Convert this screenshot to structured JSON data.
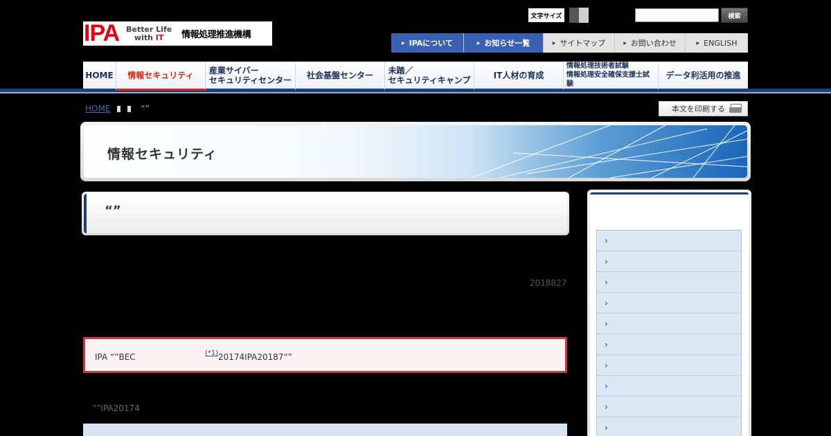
{
  "header": {
    "logo_mark": "IPA",
    "logo_tag_1": "Better Life",
    "logo_tag_2_a": "with ",
    "logo_tag_2_b": "IT",
    "logo_org": "情報処理推進機構",
    "font_size_label": "文字サイズ",
    "search_value": "",
    "search_button": "検索"
  },
  "utility_nav": [
    {
      "label": "IPAについて"
    },
    {
      "label": "お知らせ一覧"
    },
    {
      "label": "サイトマップ"
    },
    {
      "label": "お問い合わせ"
    },
    {
      "label": "ENGLISH"
    }
  ],
  "global_nav": [
    {
      "line1": "HOME",
      "line2": ""
    },
    {
      "line1": "情報セキュリティ",
      "line2": ""
    },
    {
      "line1": "産業サイバー",
      "line2": "セキュリティセンター"
    },
    {
      "line1": "社会基盤センター",
      "line2": ""
    },
    {
      "line1": "未踏／",
      "line2": "セキュリティキャンプ"
    },
    {
      "line1": "IT人材の育成",
      "line2": ""
    },
    {
      "line1": "情報処理技術者試験",
      "line2": "情報処理安全確保支援士試験"
    },
    {
      "line1": "データ利活用の推進",
      "line2": ""
    }
  ],
  "breadcrumb": {
    "home": "HOME",
    "current": "“”"
  },
  "print_button": "本文を印刷する",
  "section_title": "情報セキュリティ",
  "page_heading": "“”",
  "date": "2018827",
  "notice": {
    "text1": "IPA “”BEC",
    "note": "(*1)",
    "text2": "20174IPA20187“”"
  },
  "paragraph": "“”IPA20174",
  "sidebar": {
    "items": [
      "›",
      "›",
      "›",
      "›",
      "›",
      "›",
      "›",
      "›",
      "›",
      "›"
    ]
  },
  "colors": {
    "nav_dark": "#1b3e78",
    "nav_active": "#d32b16",
    "utility_blue": "#3b62b2",
    "notice_border": "#c8383d"
  }
}
